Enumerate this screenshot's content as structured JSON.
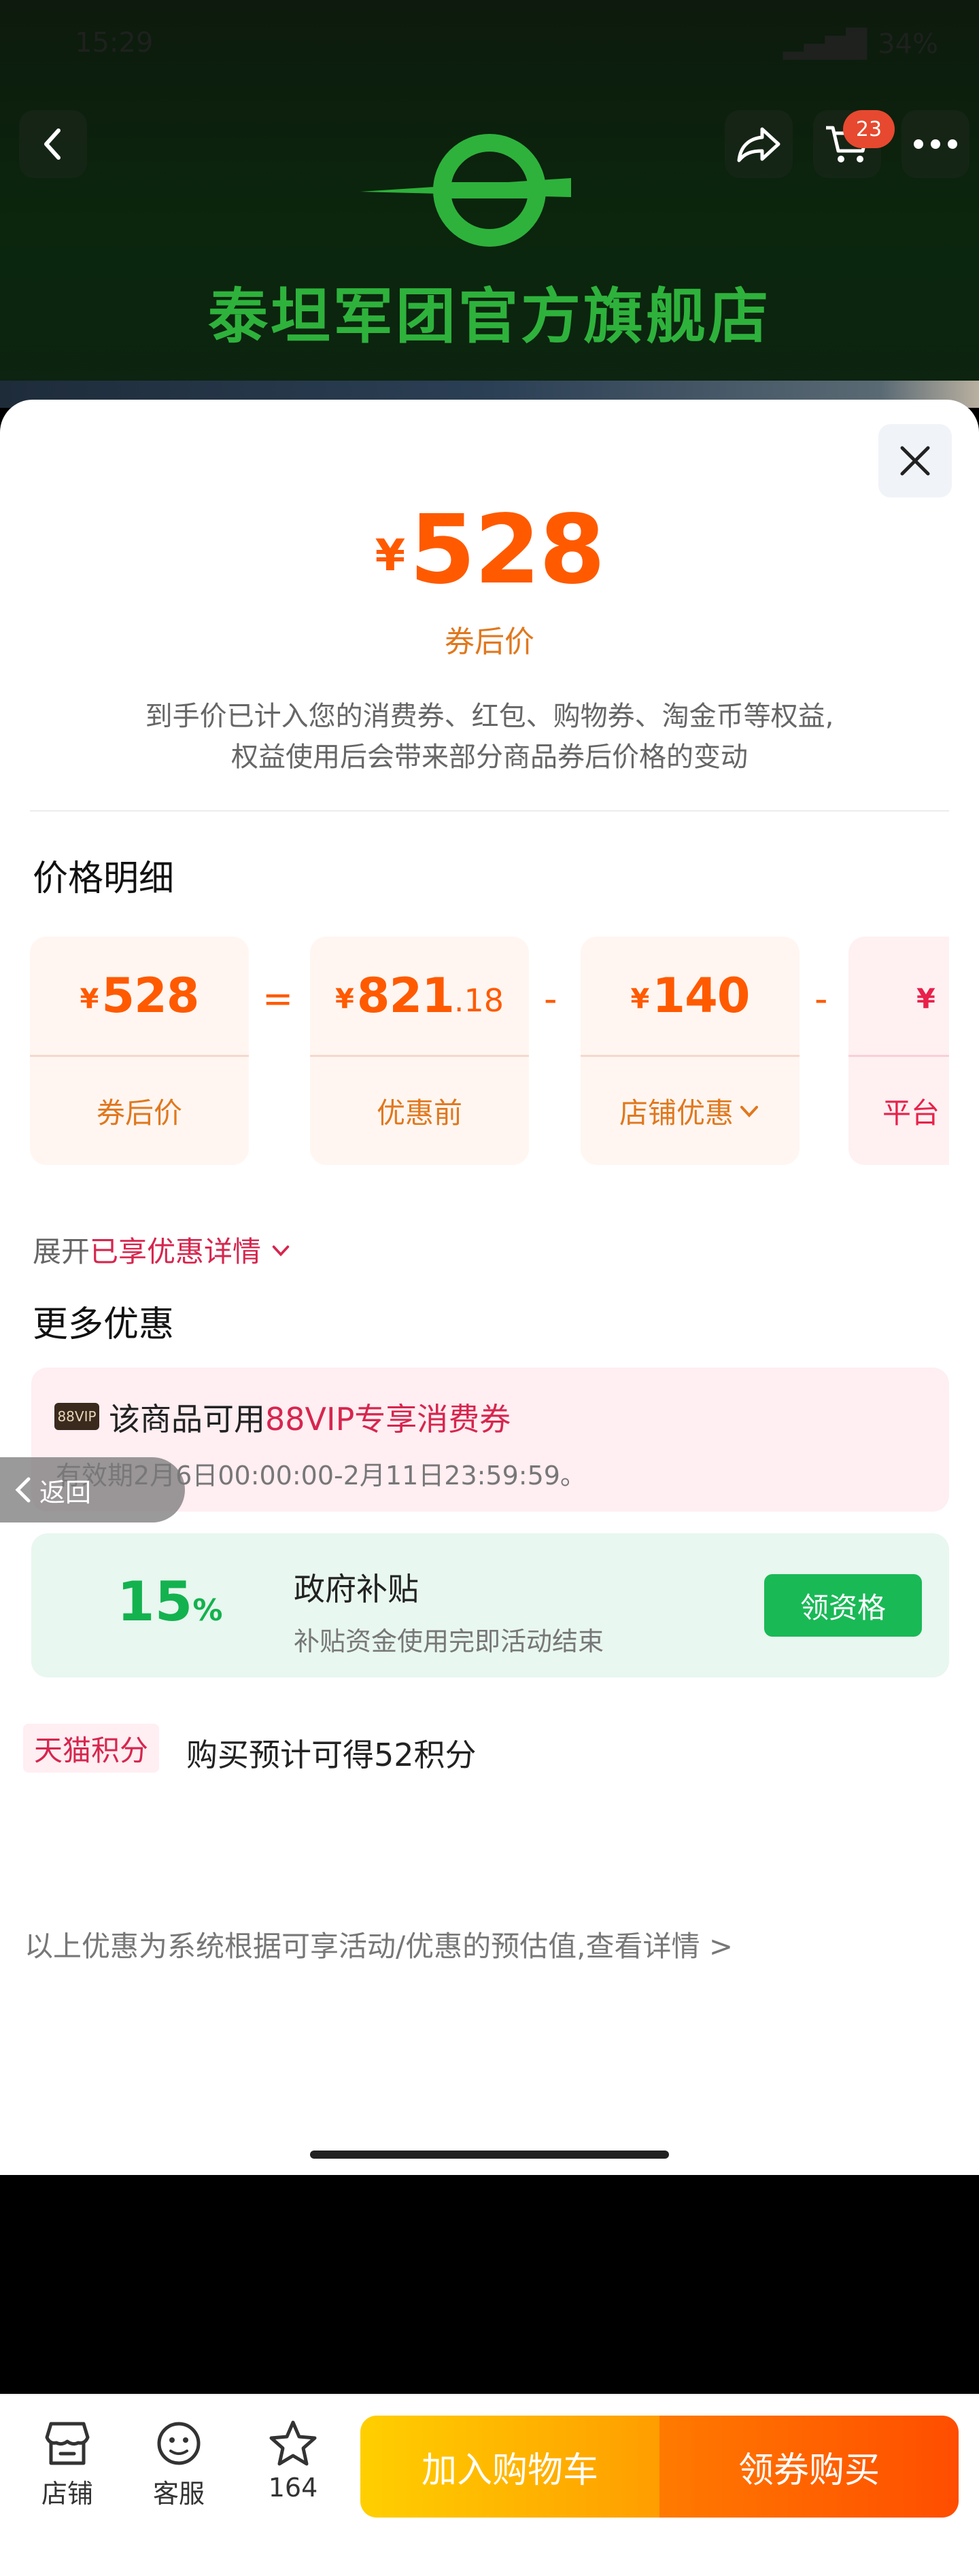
{
  "status": {
    "time": "15:29",
    "battery": "34%"
  },
  "header": {
    "shop_name": "泰坦军团官方旗舰店",
    "cart_count": "23"
  },
  "price": {
    "currency": "¥",
    "value": "528",
    "label": "券后价"
  },
  "notice": {
    "line1": "到手价已计入您的消费券、红包、购物券、淘金币等权益,",
    "line2": "权益使用后会带来部分商品券后价格的变动"
  },
  "breakdown": {
    "title": "价格明细",
    "cards": [
      {
        "currency": "¥",
        "value": "528",
        "decimals": "",
        "label": "券后价"
      },
      {
        "currency": "¥",
        "value": "821",
        "decimals": ".18",
        "label": "优惠前"
      },
      {
        "currency": "¥",
        "value": "140",
        "decimals": "",
        "label": "店铺优惠"
      },
      {
        "currency": "¥",
        "value": "",
        "decimals": "",
        "label": "平台"
      }
    ],
    "operators": [
      "=",
      "-",
      "-"
    ]
  },
  "expand": {
    "prefix": "展开",
    "highlight": "已享优惠详情"
  },
  "more": {
    "title": "更多优惠",
    "vip": {
      "tag": "88VIP",
      "prefix": "该商品可用",
      "highlight": "88VIP专享消费券",
      "validity": "有效期2月6日00:00:00-2月11日23:59:59。"
    },
    "gov": {
      "percent": "15",
      "percent_sign": "%",
      "title": "政府补贴",
      "subtitle": "补贴资金使用完即活动结束",
      "button": "领资格"
    }
  },
  "points": {
    "tag": "天猫积分",
    "text": "购买预计可得52积分"
  },
  "footnote": "以上优惠为系统根据可享活动/优惠的预估值,查看详情 >",
  "back_button": "返回",
  "bottom_bar": {
    "store": "店铺",
    "service": "客服",
    "favorites": "164",
    "add_to_cart": "加入购物车",
    "buy": "领券购买"
  },
  "colors": {
    "price": "#ff5a00",
    "label": "#e0781e",
    "highlight": "#d6264e",
    "green": "#19b956"
  }
}
